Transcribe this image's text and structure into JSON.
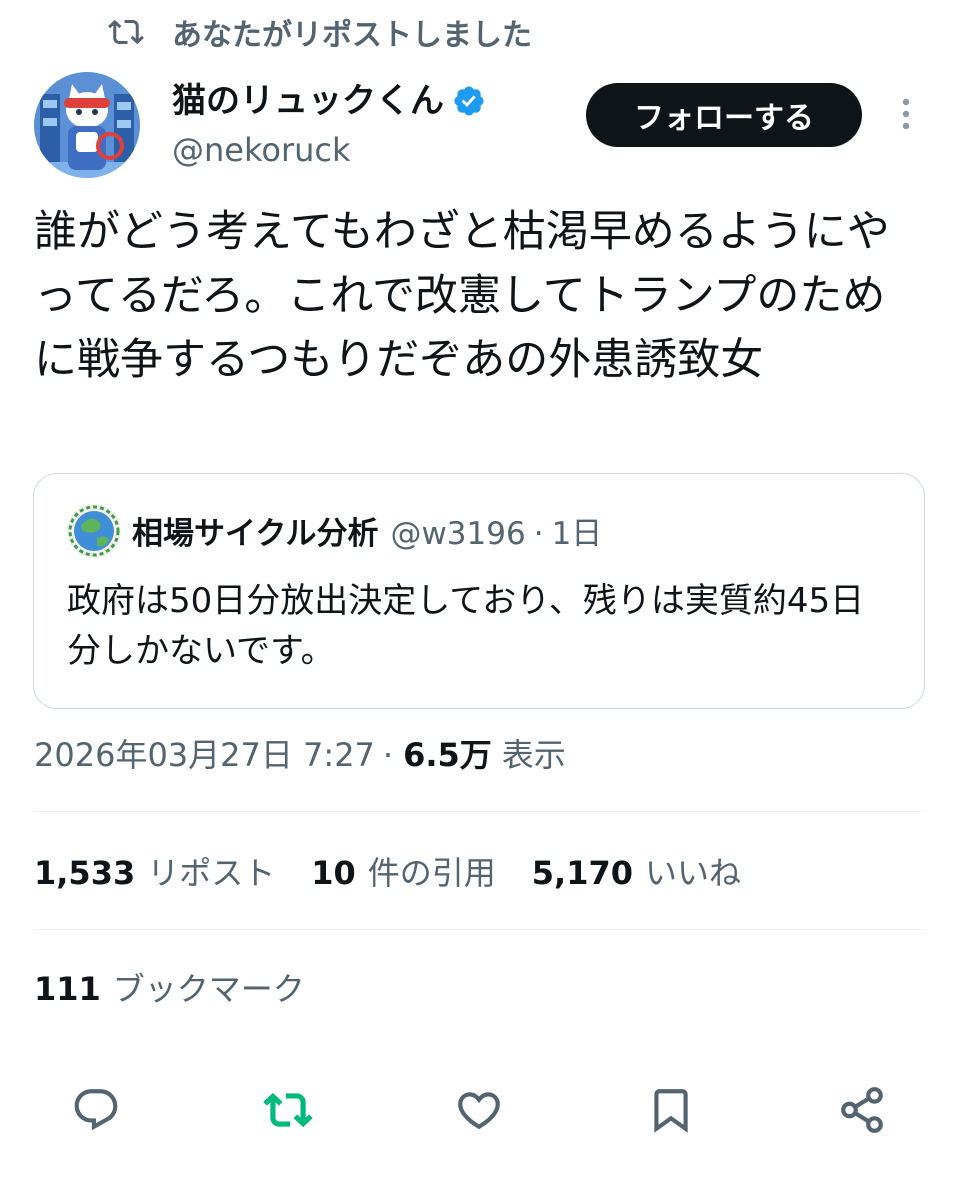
{
  "social_context": {
    "text": "あなたがリポストしました"
  },
  "author": {
    "name": "猫のリュックくん",
    "handle": "@nekoruck",
    "verified": true
  },
  "follow_button": {
    "label": "フォローする"
  },
  "tweet": {
    "text": "誰がどう考えてもわざと枯渇早めるようにやってるだろ。これで改憲してトランプのために戦争するつもりだぞあの外患誘致女"
  },
  "quote": {
    "name": "相場サイクル分析",
    "handle": "@w3196",
    "separator": "·",
    "time": "1日",
    "text": "政府は50日分放出決定しており、残りは実質約45日分しかないです。"
  },
  "meta": {
    "timestamp": "2026年03月27日 7:27",
    "separator": "·",
    "views": "6.5万",
    "views_label": "表示"
  },
  "stats": [
    {
      "count": "1,533",
      "label": "リポスト"
    },
    {
      "count": "10",
      "label": "件の引用"
    },
    {
      "count": "5,170",
      "label": "いいね"
    }
  ],
  "bookmarks": {
    "count": "111",
    "label": "ブックマーク"
  },
  "actions": [
    "reply-icon",
    "repost-icon",
    "like-icon",
    "bookmark-icon",
    "share-icon"
  ],
  "colors": {
    "text": "#0f1419",
    "secondary": "#536471",
    "verified": "#1d9bf0",
    "reposted": "#00ba7c",
    "border": "#cfd9de"
  }
}
